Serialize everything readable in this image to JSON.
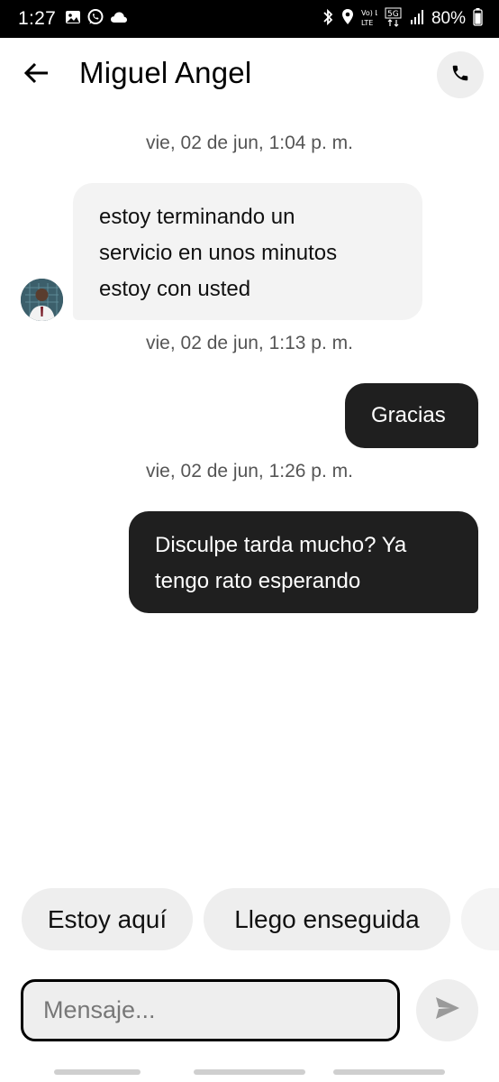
{
  "status_bar": {
    "time": "1:27",
    "left_icons": [
      "gallery-icon",
      "whatsapp-icon",
      "cloud-icon"
    ],
    "right_icons": [
      "bluetooth-icon",
      "location-icon",
      "volte-icon",
      "5g-icon",
      "signal-icon",
      "battery-icon"
    ],
    "volte_label": "Vo) LTE",
    "network_label": "5G",
    "battery": "80%"
  },
  "header": {
    "contact_name": "Miguel Angel",
    "back_icon": "arrow-left-icon",
    "call_icon": "phone-icon"
  },
  "conversation": [
    {
      "type": "timestamp",
      "text": "vie, 02 de jun, 1:04 p. m."
    },
    {
      "type": "incoming",
      "lines": [
        "estoy terminando un",
        "servicio en unos minutos",
        "estoy con usted"
      ]
    },
    {
      "type": "timestamp",
      "text": "vie, 02 de jun, 1:13 p. m."
    },
    {
      "type": "outgoing",
      "lines": [
        "Gracias"
      ]
    },
    {
      "type": "timestamp",
      "text": "vie, 02 de jun, 1:26 p. m."
    },
    {
      "type": "outgoing",
      "lines": [
        "Disculpe tarda mucho? Ya",
        "tengo rato esperando"
      ]
    }
  ],
  "quick_replies": [
    "Estoy aquí",
    "Llego enseguida"
  ],
  "composer": {
    "placeholder": "Mensaje...",
    "value": "",
    "send_icon": "send-icon"
  },
  "colors": {
    "outgoing_bubble": "#1f1f1f",
    "incoming_bubble": "#f3f3f3",
    "chip_background": "#eeeeee"
  }
}
